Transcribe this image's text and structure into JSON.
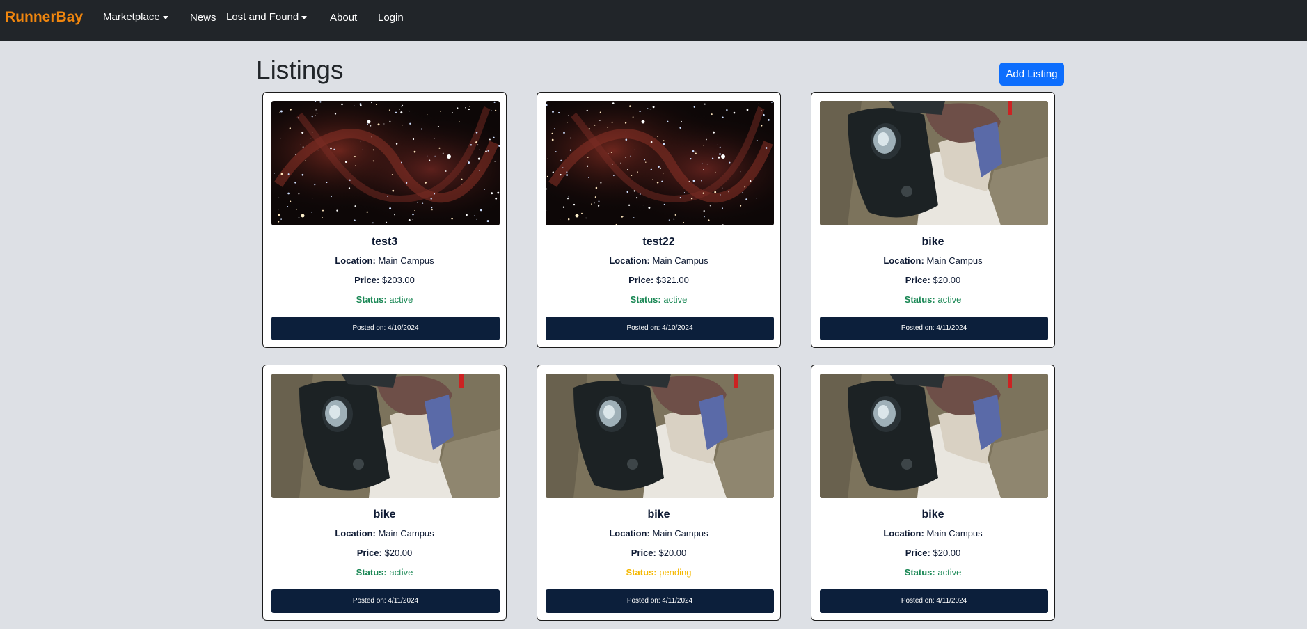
{
  "navbar": {
    "brand": "RunnerBay",
    "items": [
      {
        "label": "Marketplace",
        "dropdown": true
      },
      {
        "label": "News",
        "dropdown": false
      },
      {
        "label": "Lost and Found",
        "dropdown": true
      },
      {
        "label": "About",
        "dropdown": false
      },
      {
        "label": "Login",
        "dropdown": false
      }
    ]
  },
  "page": {
    "title": "Listings",
    "add_button": "Add Listing"
  },
  "labels": {
    "location": "Location:",
    "price": "Price:",
    "status": "Status:",
    "posted": "Posted on:"
  },
  "listings": [
    {
      "title": "test3",
      "location": "Main Campus",
      "price": "$203.00",
      "status": "active",
      "posted": "4/10/2024",
      "image": "galaxy-image"
    },
    {
      "title": "test22",
      "location": "Main Campus",
      "price": "$321.00",
      "status": "active",
      "posted": "4/10/2024",
      "image": "galaxy-image"
    },
    {
      "title": "bike",
      "location": "Main Campus",
      "price": "$20.00",
      "status": "active",
      "posted": "4/11/2024",
      "image": "scooter-image"
    },
    {
      "title": "bike",
      "location": "Main Campus",
      "price": "$20.00",
      "status": "active",
      "posted": "4/11/2024",
      "image": "scooter-image"
    },
    {
      "title": "bike",
      "location": "Main Campus",
      "price": "$20.00",
      "status": "pending",
      "posted": "4/11/2024",
      "image": "scooter-image"
    },
    {
      "title": "bike",
      "location": "Main Campus",
      "price": "$20.00",
      "status": "active",
      "posted": "4/11/2024",
      "image": "scooter-image"
    }
  ],
  "colors": {
    "brand": "#f0860e",
    "navbar_bg": "#212529",
    "primary_button": "#0d6efd",
    "card_footer": "#0c1f3b",
    "status_active": "#198754",
    "status_pending": "#f5b800",
    "page_bg": "#dde0e5"
  }
}
